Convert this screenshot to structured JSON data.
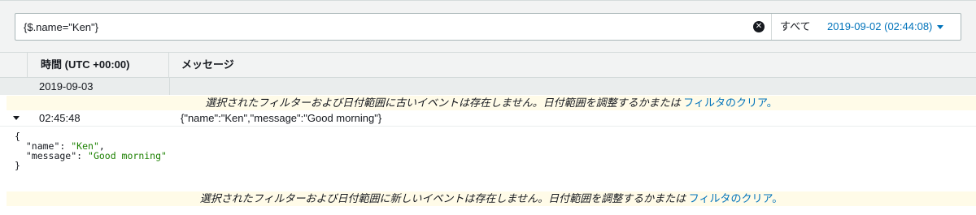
{
  "filter": {
    "value": "{$.name=\"Ken\"}",
    "all_label": "すべて",
    "date_range": "2019-09-02 (02:44:08)"
  },
  "table": {
    "columns": [
      "時間 (UTC +00:00)",
      "メッセージ"
    ],
    "date_group": "2019-09-03",
    "notice_older": {
      "text": "選択されたフィルターおよび日付範囲に古いイベントは存在しません。日付範囲を調整するかまたは",
      "link": "フィルタのクリア。"
    },
    "event": {
      "time": "02:45:48",
      "message": "{\"name\":\"Ken\",\"message\":\"Good morning\"}"
    },
    "expanded_json": {
      "open_brace": "{",
      "line1_key": "  \"name\": ",
      "line1_val": "\"Ken\"",
      "line1_tail": ",",
      "line2_key": "  \"message\": ",
      "line2_val": "\"Good morning\"",
      "close_brace": "}"
    },
    "notice_newer": {
      "text": "選択されたフィルターおよび日付範囲に新しいイベントは存在しません。日付範囲を調整するかまたは",
      "link": "フィルタのクリア。"
    }
  },
  "colors": {
    "link": "#0073bb",
    "json_value": "#1d8102",
    "notice_bg": "#fffbe8"
  }
}
